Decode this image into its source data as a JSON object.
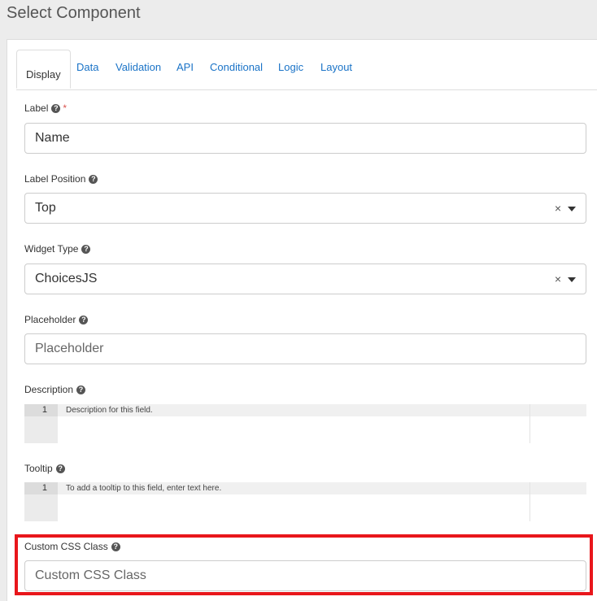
{
  "title": "Select Component",
  "tabs": [
    {
      "label": "Display",
      "active": true
    },
    {
      "label": "Data"
    },
    {
      "label": "Validation"
    },
    {
      "label": "API"
    },
    {
      "label": "Conditional"
    },
    {
      "label": "Logic"
    },
    {
      "label": "Layout"
    }
  ],
  "fields": {
    "label": {
      "label": "Label",
      "required_mark": "*",
      "value": "Name"
    },
    "label_position": {
      "label": "Label Position",
      "value": "Top",
      "clear": "×"
    },
    "widget_type": {
      "label": "Widget Type",
      "value": "ChoicesJS",
      "clear": "×"
    },
    "placeholder": {
      "label": "Placeholder",
      "placeholder": "Placeholder"
    },
    "description": {
      "label": "Description",
      "line_number": "1",
      "text": "Description for this field."
    },
    "tooltip": {
      "label": "Tooltip",
      "line_number": "1",
      "text": "To add a tooltip to this field, enter text here."
    },
    "custom_css_class": {
      "label": "Custom CSS Class",
      "placeholder": "Custom CSS Class"
    }
  },
  "colors": {
    "link": "#1a73c7",
    "highlight": "#e8161b",
    "required": "#d9534f"
  },
  "icons": {
    "help": "question-circle-icon",
    "dropdown": "caret-down-icon",
    "clear": "clear-x-icon"
  }
}
